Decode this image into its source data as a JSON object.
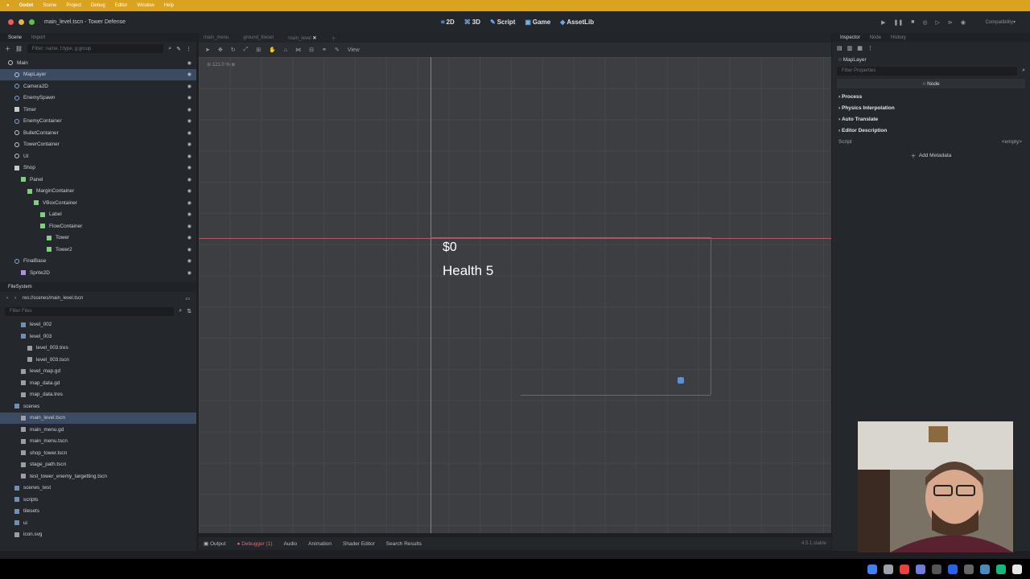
{
  "menubar": {
    "app": "Godot",
    "items": [
      "Scene",
      "Project",
      "Debug",
      "Editor",
      "Window",
      "Help"
    ]
  },
  "window": {
    "title": "main_level.tscn - Tower Defense",
    "modes": [
      "2D",
      "3D",
      "Script",
      "Game",
      "AssetLib"
    ],
    "renderer": "Compatibility"
  },
  "scene_dock": {
    "tabs": [
      "Scene",
      "Import"
    ],
    "filter_placeholder": "Filter: name, t:type, g:group",
    "tree": [
      {
        "label": "Main",
        "indent": 0,
        "icon": "node-circle",
        "color": "#c6cbd2"
      },
      {
        "label": "MapLayer",
        "indent": 1,
        "icon": "node-circle",
        "color": "#c6cbd2",
        "selected": true
      },
      {
        "label": "Camera2D",
        "indent": 1,
        "icon": "camera-icon",
        "color": "#7ea8e6"
      },
      {
        "label": "EnemySpawn",
        "indent": 1,
        "icon": "node-circle",
        "color": "#7ea8e6"
      },
      {
        "label": "Timer",
        "indent": 1,
        "icon": "timer-icon",
        "color": "#c6cbd2"
      },
      {
        "label": "EnemyContainer",
        "indent": 1,
        "icon": "node-circle",
        "color": "#7ea8e6"
      },
      {
        "label": "BulletContainer",
        "indent": 1,
        "icon": "node-circle",
        "color": "#c6cbd2"
      },
      {
        "label": "TowerContainer",
        "indent": 1,
        "icon": "node-circle",
        "color": "#c6cbd2"
      },
      {
        "label": "UI",
        "indent": 1,
        "icon": "node-circle",
        "color": "#c6cbd2"
      },
      {
        "label": "Shop",
        "indent": 1,
        "icon": "canvas-icon",
        "color": "#c6cbd2"
      },
      {
        "label": "Panel",
        "indent": 2,
        "icon": "control-square",
        "color": "#7ed07e"
      },
      {
        "label": "MarginContainer",
        "indent": 3,
        "icon": "control-square",
        "color": "#7ed07e"
      },
      {
        "label": "VBoxContainer",
        "indent": 4,
        "icon": "control-square",
        "color": "#7ed07e"
      },
      {
        "label": "Label",
        "indent": 5,
        "icon": "control-square",
        "color": "#7ed07e"
      },
      {
        "label": "FlowContainer",
        "indent": 5,
        "icon": "control-square",
        "color": "#7ed07e"
      },
      {
        "label": "Tower",
        "indent": 6,
        "icon": "control-square",
        "color": "#7ed07e"
      },
      {
        "label": "Tower2",
        "indent": 6,
        "icon": "control-square",
        "color": "#7ed07e"
      },
      {
        "label": "FinalBase",
        "indent": 1,
        "icon": "node-circle",
        "color": "#7ea8e6"
      },
      {
        "label": "Sprite2D",
        "indent": 2,
        "icon": "sprite-icon",
        "color": "#b58be0"
      }
    ]
  },
  "filesystem": {
    "title": "FileSystem",
    "path": "res://scenes/main_level.tscn",
    "filter_placeholder": "Filter Files",
    "items": [
      {
        "label": "level_002",
        "indent": 1,
        "type": "folder"
      },
      {
        "label": "level_003",
        "indent": 1,
        "type": "folder"
      },
      {
        "label": "level_003.tres",
        "indent": 2,
        "type": "file"
      },
      {
        "label": "level_003.tscn",
        "indent": 2,
        "type": "file"
      },
      {
        "label": "level_map.gd",
        "indent": 1,
        "type": "file"
      },
      {
        "label": "map_data.gd",
        "indent": 1,
        "type": "file"
      },
      {
        "label": "map_data.tres",
        "indent": 1,
        "type": "file"
      },
      {
        "label": "scenes",
        "indent": 0,
        "type": "folder"
      },
      {
        "label": "main_level.tscn",
        "indent": 1,
        "type": "file",
        "selected": true
      },
      {
        "label": "main_menu.gd",
        "indent": 1,
        "type": "file"
      },
      {
        "label": "main_menu.tscn",
        "indent": 1,
        "type": "file"
      },
      {
        "label": "shop_tower.tscn",
        "indent": 1,
        "type": "file"
      },
      {
        "label": "stage_path.tscn",
        "indent": 1,
        "type": "file"
      },
      {
        "label": "test_tower_enemy_targetting.tscn",
        "indent": 1,
        "type": "file"
      },
      {
        "label": "scenes_test",
        "indent": 0,
        "type": "folder"
      },
      {
        "label": "scripts",
        "indent": 0,
        "type": "folder"
      },
      {
        "label": "tilesets",
        "indent": 0,
        "type": "folder"
      },
      {
        "label": "ui",
        "indent": 0,
        "type": "folder"
      },
      {
        "label": "icon.svg",
        "indent": 0,
        "type": "file"
      }
    ]
  },
  "editor": {
    "scene_tabs": [
      "main_menu",
      "ground_tileset",
      "main_level"
    ],
    "view_menu": "View",
    "zoom": "121.0 %",
    "canvas_text": {
      "money": "$0",
      "health": "Health 5"
    }
  },
  "bottom_panel": {
    "tabs": [
      "Output",
      "Debugger (1)",
      "Audio",
      "Animation",
      "Shader Editor",
      "Search Results"
    ],
    "version": "4.5.1.stable"
  },
  "inspector": {
    "tabs": [
      "Inspector",
      "Node",
      "History"
    ],
    "object": "MapLayer",
    "filter_placeholder": "Filter Properties",
    "header": "Node",
    "sections": [
      "Process",
      "Physics Interpolation",
      "Auto Translate",
      "Editor Description"
    ],
    "script_label": "Script",
    "script_value": "<empty>",
    "add_metadata": "Add Metadata"
  }
}
